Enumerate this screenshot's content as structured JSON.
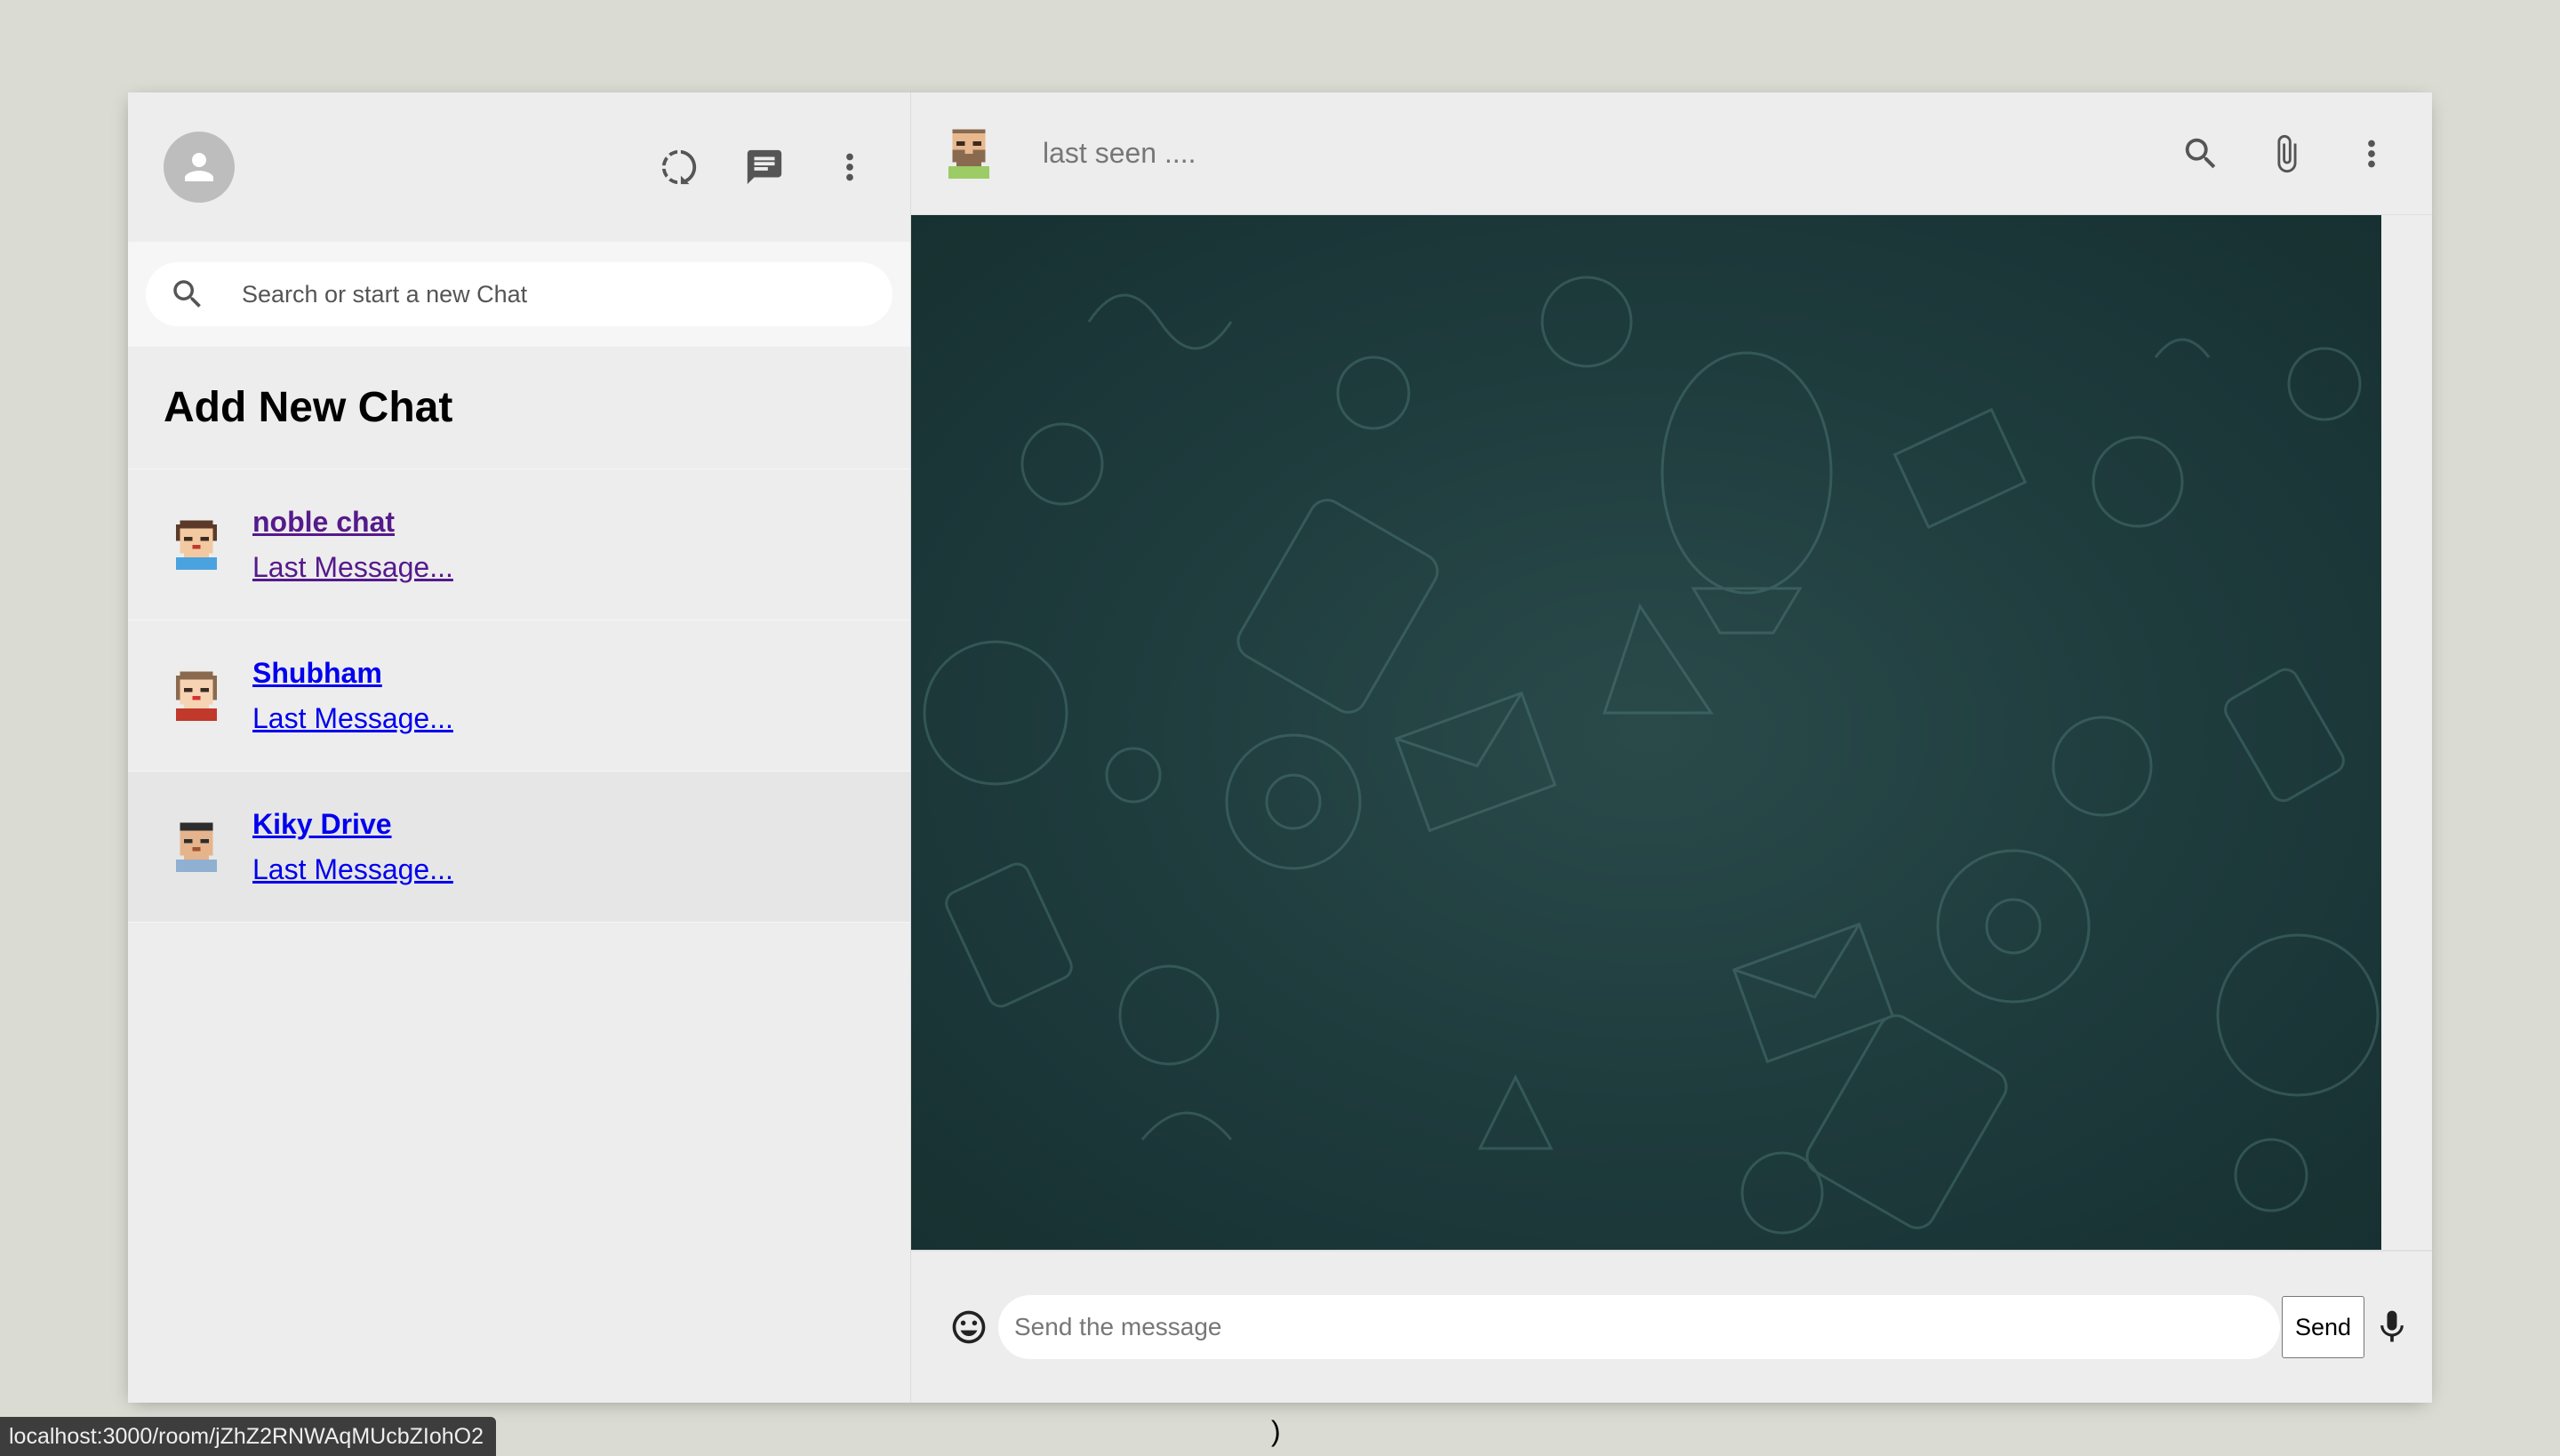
{
  "sidebar": {
    "search_placeholder": "Search or start a new Chat",
    "add_new_chat": "Add New Chat",
    "chats": [
      {
        "name": "noble chat",
        "last_message": "Last Message..."
      },
      {
        "name": "Shubham",
        "last_message": "Last Message..."
      },
      {
        "name": "Kiky Drive",
        "last_message": "Last Message..."
      }
    ],
    "icons": [
      "person-icon",
      "status-icon",
      "chat-icon",
      "more-vert-icon",
      "search-icon"
    ]
  },
  "chat": {
    "status": "last seen ....",
    "icons": [
      "search-icon",
      "attach-file-icon",
      "more-vert-icon"
    ],
    "input_placeholder": "Send the message",
    "send_label": "Send",
    "footer_icons": [
      "emoji-icon",
      "mic-icon"
    ]
  },
  "browser": {
    "status_url": "localhost:3000/room/jZhZ2RNWAqMUcbZIohO2",
    "stray_text": ")"
  },
  "colors": {
    "app_bg": "#dadbd3",
    "panel": "#ededed",
    "chat_bg": "#1e3b3c",
    "link": "#0000ee",
    "visited_link": "#551a8b"
  }
}
